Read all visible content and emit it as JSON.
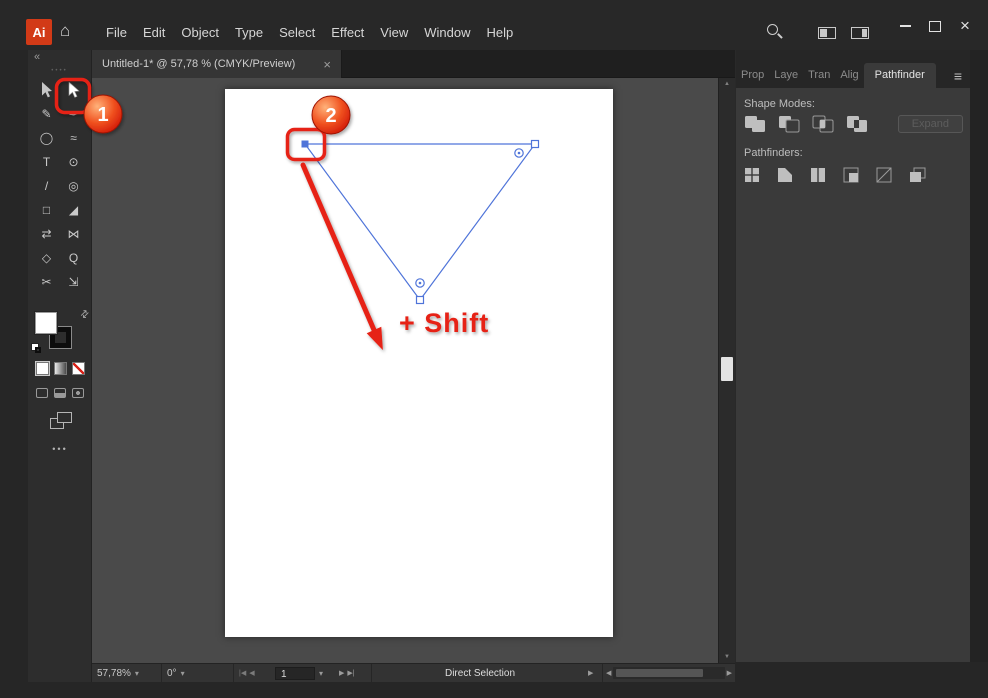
{
  "header": {
    "logo_text": "Ai",
    "menus": [
      "File",
      "Edit",
      "Object",
      "Type",
      "Select",
      "Effect",
      "View",
      "Window",
      "Help"
    ]
  },
  "glyphs": {
    "home": "⌂",
    "hamburger": "≡",
    "swap": "⇄",
    "chevron_down": "▾",
    "nav_first": "|◀",
    "nav_prev": "◀",
    "nav_next": "▶",
    "nav_last": "▶|",
    "scroll_left": "◀",
    "scroll_right": "▶",
    "scroll_up": "▲",
    "scroll_down": "▼",
    "status_arrow": "▶",
    "window_close": "×",
    "tab_close": "×",
    "collapse": "«",
    "grip_dots": "••••",
    "ellipsis": "•••"
  },
  "document_tab": {
    "title": "Untitled-1* @ 57,78 % (CMYK/Preview)"
  },
  "toolbar": {
    "tools": [
      {
        "name": "selection-tool",
        "glyph": ""
      },
      {
        "name": "direct-selection-tool",
        "glyph": ""
      },
      {
        "name": "pencil-tool",
        "glyph": "✎"
      },
      {
        "name": "pen-tool",
        "glyph": "✒"
      },
      {
        "name": "ellipse-tool",
        "glyph": "◯"
      },
      {
        "name": "paintbrush-tool",
        "glyph": "≈"
      },
      {
        "name": "type-tool",
        "glyph": "T"
      },
      {
        "name": "rotate-tool",
        "glyph": "⊙"
      },
      {
        "name": "line-segment-tool",
        "glyph": "/"
      },
      {
        "name": "curvature-tool",
        "glyph": "◎"
      },
      {
        "name": "rectangle-tool",
        "glyph": "□"
      },
      {
        "name": "eyedropper-tool",
        "glyph": "◢"
      },
      {
        "name": "shear-tool",
        "glyph": "⇄"
      },
      {
        "name": "width-tool",
        "glyph": "⋈"
      },
      {
        "name": "hand-tool",
        "glyph": "◇"
      },
      {
        "name": "zoom-tool",
        "glyph": "Q"
      },
      {
        "name": "scissors-tool",
        "glyph": "✂"
      },
      {
        "name": "free-transform-tool",
        "glyph": "⇲"
      }
    ]
  },
  "canvas": {
    "annotations": [
      {
        "number": "1"
      },
      {
        "number": "2"
      }
    ],
    "shift_label": "+ Shift"
  },
  "panel": {
    "tabs": [
      "Prop",
      "Laye",
      "Tran",
      "Alig"
    ],
    "active_tab": "Pathfinder",
    "shape_modes_label": "Shape Modes:",
    "expand_label": "Expand",
    "pathfinders_label": "Pathfinders:",
    "shape_mode_icons": [
      "unite",
      "minus-front",
      "intersect",
      "exclude"
    ],
    "pathfinder_icons": [
      "divide",
      "trim",
      "merge",
      "crop",
      "outline",
      "minus-back"
    ]
  },
  "status_bar": {
    "zoom": "57,78%",
    "rotation": "0°",
    "page": "1",
    "tool_status": "Direct Selection"
  },
  "colors": {
    "accent_blue": "#4f74d9",
    "annotation_red": "#e62417",
    "artboard_white": "#ffffff"
  }
}
